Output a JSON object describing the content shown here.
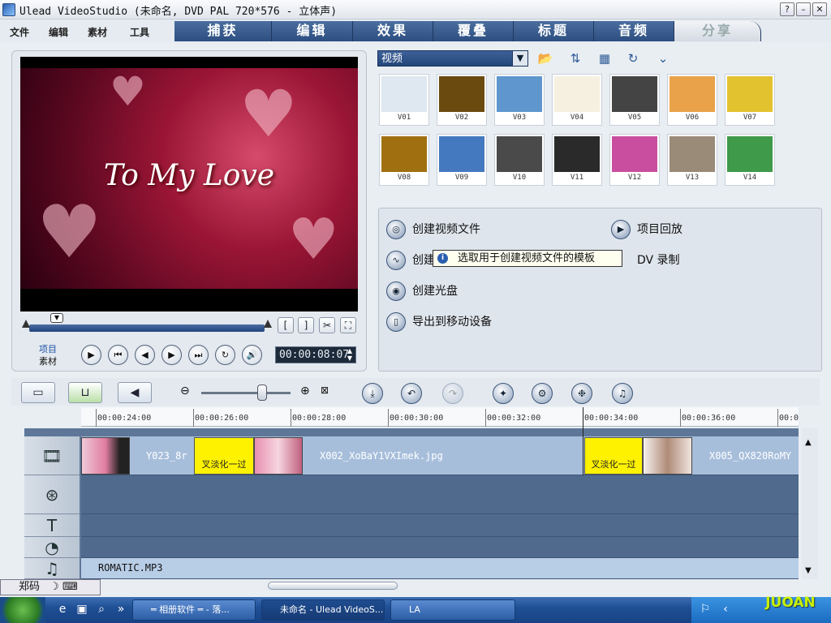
{
  "window": {
    "title": "Ulead VideoStudio (未命名, DVD PAL 720*576 - 立体声)",
    "help_label": "?",
    "minimize_label": "–",
    "close_label": "✕"
  },
  "menu": [
    "文件",
    "编辑",
    "素材",
    "工具"
  ],
  "tabs": [
    "捕获",
    "编辑",
    "效果",
    "覆叠",
    "标题",
    "音频",
    "分享"
  ],
  "active_tab": "分享",
  "preview": {
    "caption": "To My Love",
    "mode_project": "项目",
    "mode_clip": "素材",
    "timecode": "00:00:08:07"
  },
  "library": {
    "dropdown_value": "视频",
    "thumbnails": [
      {
        "label": "V01",
        "color": "#dfe7f0"
      },
      {
        "label": "V02",
        "color": "#6b4a10"
      },
      {
        "label": "V03",
        "color": "#5e96cd"
      },
      {
        "label": "V04",
        "color": "#f5f0e0"
      },
      {
        "label": "V05",
        "color": "#444444"
      },
      {
        "label": "V06",
        "color": "#e9a24a"
      },
      {
        "label": "V07",
        "color": "#e3c230"
      },
      {
        "label": "V08",
        "color": "#a07010"
      },
      {
        "label": "V09",
        "color": "#4479c0"
      },
      {
        "label": "V10",
        "color": "#4a4a4a"
      },
      {
        "label": "V11",
        "color": "#2a2a2a"
      },
      {
        "label": "V12",
        "color": "#c94e9f"
      },
      {
        "label": "V13",
        "color": "#9a8a78"
      },
      {
        "label": "V14",
        "color": "#3f9a4a"
      }
    ]
  },
  "share": {
    "create_video": "创建视频文件",
    "create_sound": "创建",
    "create_disc": "创建光盘",
    "export_mobile": "导出到移动设备",
    "project_playback": "项目回放",
    "dv_record": "DV 录制",
    "tooltip": "选取用于创建视频文件的模板"
  },
  "timeline": {
    "ruler": [
      "00:00:24:00",
      "00:00:26:00",
      "00:00:28:00",
      "00:00:30:00",
      "00:00:32:00",
      "00:00:34:00",
      "00:00:36:00",
      "00:0"
    ],
    "clip_labels": [
      "Y023_8r",
      "X002_XoBaY1VXImek.jpg",
      "X005_QX820RoMY"
    ],
    "transition_label": "叉淡化一过",
    "audio_clip": "ROMATIC.MP3"
  },
  "ime": {
    "label": "郑码"
  },
  "taskbar": {
    "tasks": [
      "═ 相册软件 ═ - 落...",
      "未命名 - Ulead VideoS...",
      "LA"
    ],
    "logo": "JUOAN"
  }
}
